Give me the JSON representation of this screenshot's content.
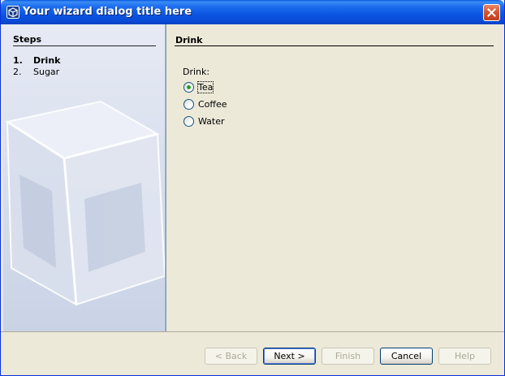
{
  "window": {
    "title": "Your wizard dialog title here",
    "app_icon": "cube-icon",
    "close_icon": "close-icon"
  },
  "steps": {
    "heading": "Steps",
    "items": [
      {
        "number": "1.",
        "label": "Drink",
        "current": true
      },
      {
        "number": "2.",
        "label": "Sugar",
        "current": false
      }
    ]
  },
  "panel": {
    "heading": "Drink",
    "field_label": "Drink:",
    "options": [
      {
        "label": "Tea",
        "selected": true
      },
      {
        "label": "Coffee",
        "selected": false
      },
      {
        "label": "Water",
        "selected": false
      }
    ]
  },
  "buttons": {
    "back": "< Back",
    "next": "Next >",
    "finish": "Finish",
    "cancel": "Cancel",
    "help": "Help"
  },
  "colors": {
    "titlebar": "#0a55e2",
    "close_button": "#d5512e",
    "dialog_bg": "#ece9d8",
    "steps_bg": "#dde3f1",
    "radio_dot": "#21a121"
  }
}
